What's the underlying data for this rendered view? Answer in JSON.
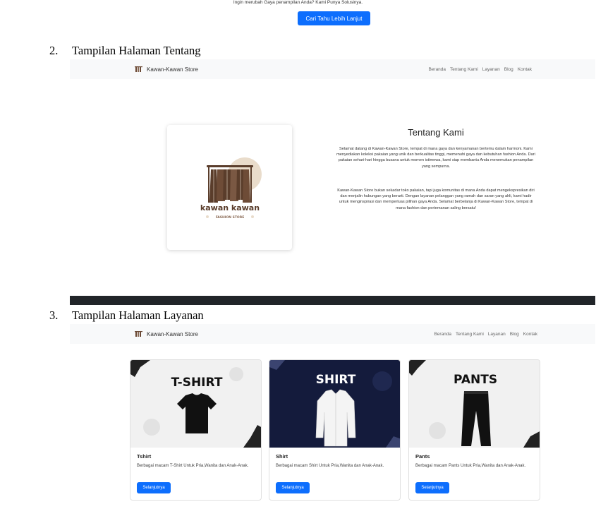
{
  "top": {
    "tagline": "Ingin merubah Gaya penampilan Anda? Kami Punya Solusinya.",
    "button": "Cari Tahu Lebih Lanjut"
  },
  "headings": [
    {
      "num": "2.",
      "text": "Tampilan Halaman Tentang"
    },
    {
      "num": "3.",
      "text": "Tampilan Halaman Layanan"
    }
  ],
  "about_page": {
    "brand": "Kawan-Kawan Store",
    "nav": [
      "Beranda",
      "Tentang Kami",
      "Layanan",
      "Blog",
      "Kontak"
    ],
    "logo_text": "kawan kawan",
    "logo_sub": "FASHION STORE",
    "title": "Tentang Kami",
    "para1": "Selamat datang di Kawan-Kawan Store, tempat di mana gaya dan kenyamanan bertemu dalam harmoni. Kami menyediakan koleksi pakaian yang unik dan berkualitas tinggi, memenuhi gaya dan kebutuhan fashion Anda. Dari pakaian sehari-hari hingga busana untuk momen istimewa, kami siap membantu Anda menemukan penampilan yang sempurna.",
    "para2": "Kawan-Kawan Store bukan sekadar toko pakaian, tapi juga komunitas di mana Anda dapat mengekspresikan diri dan menjalin hubungan yang berarti. Dengan layanan pelanggan yang ramah dan saran yang ahli, kami hadir untuk menginspirasi dan memperluas pilihan gaya Anda. Selamat berbelanja di Kawan-Kawan Store, tempat di mana fashion dan pertemanan saling bersatu!"
  },
  "services_page": {
    "brand": "Kawan-Kawan Store",
    "nav": [
      "Beranda",
      "Tentang Kami",
      "Layanan",
      "Blog",
      "Kontak"
    ],
    "cards": [
      {
        "banner": "T-SHIRT",
        "title": "Tshirt",
        "text": "Berbagai macam T-Shirt Untuk Pria,Wanita dan Anak-Anak.",
        "button": "Selanjutnya"
      },
      {
        "banner": "SHIRT",
        "title": "Shirt",
        "text": "Berbagai macam Shirt Untuk Pria,Wanita dan Anak-Anak.",
        "button": "Selanjutnya"
      },
      {
        "banner": "PANTS",
        "title": "Pants",
        "text": "Berbagai macam Pants Untuk Pria,Wanita dan Anak-Anak.",
        "button": "Selanjutnya"
      }
    ]
  },
  "colors": {
    "primary": "#0d6efd",
    "navbar_bg": "#f8f9fa",
    "footer_dark": "#212529",
    "logo_brown": "#5a3d2b",
    "logo_circle": "#e9dccb",
    "shirt_banner_bg": "#141b3c"
  }
}
